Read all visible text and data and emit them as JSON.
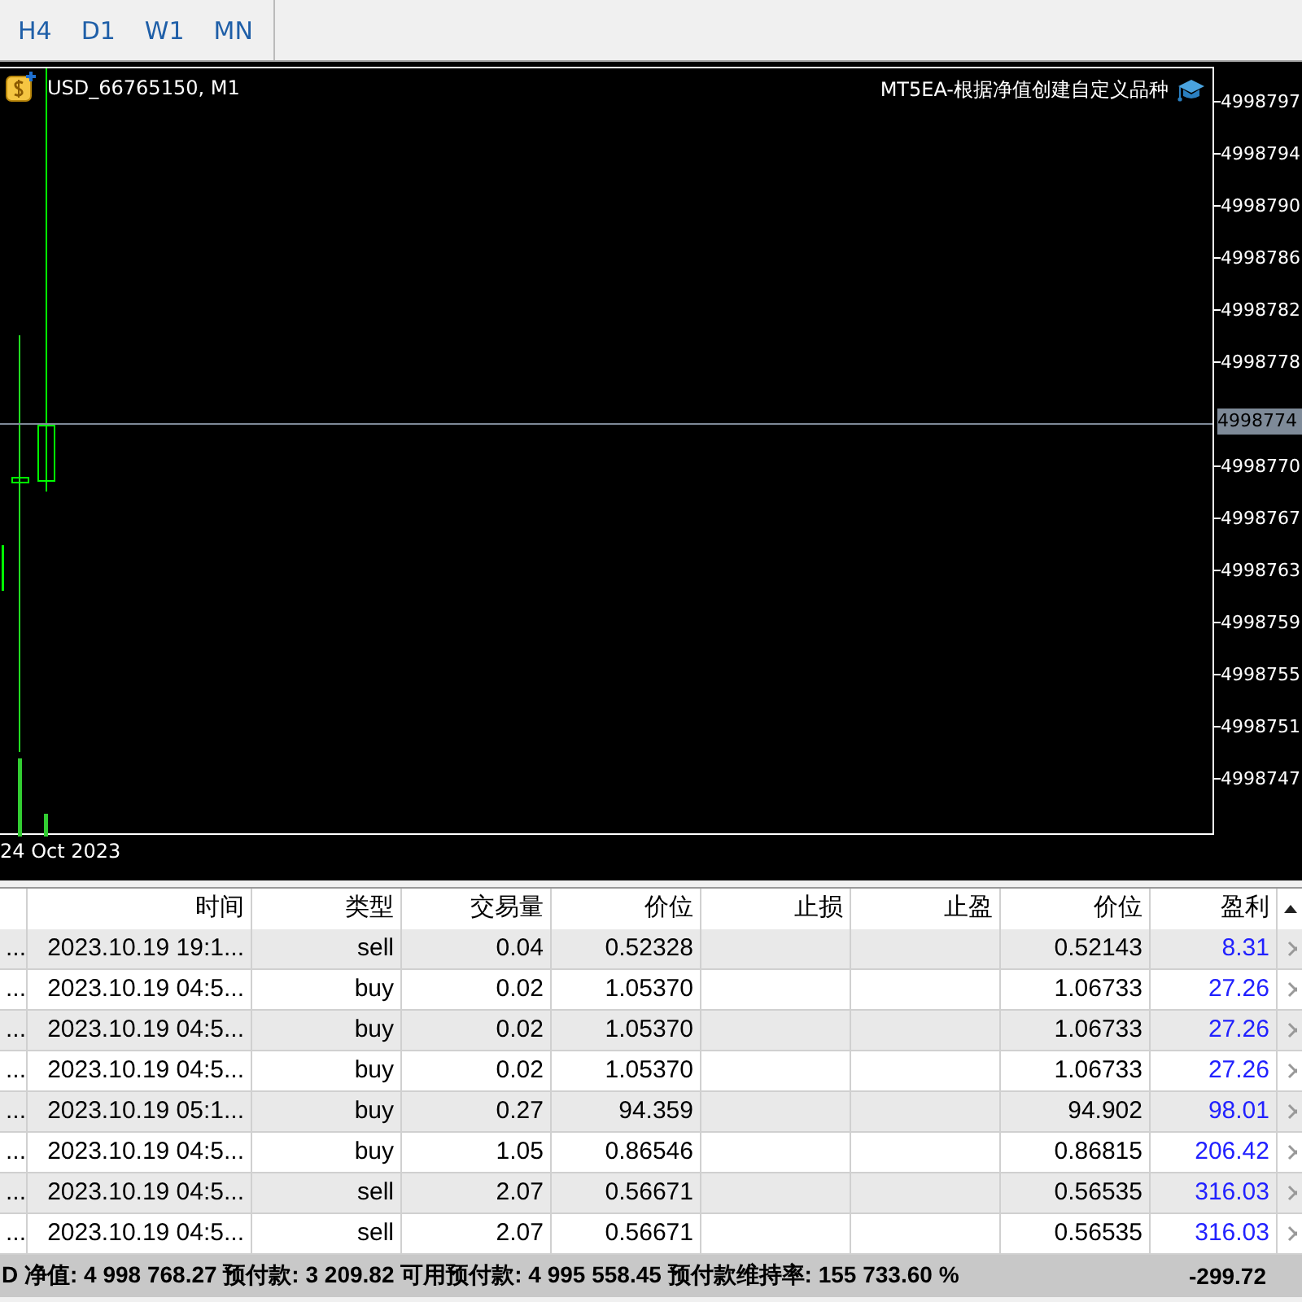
{
  "toolbar": {
    "timeframes": [
      {
        "label": "H4",
        "selected": false
      },
      {
        "label": "D1",
        "selected": false
      },
      {
        "label": "W1",
        "selected": false
      },
      {
        "label": "MN",
        "selected": false
      }
    ]
  },
  "chart": {
    "symbol": "USD_66765150, M1",
    "expert": "MT5EA-根据净值创建自定义品种",
    "price_axis": [
      "4998797",
      "4998794",
      "4998790",
      "4998786",
      "4998782",
      "4998778",
      "4998770",
      "4998767",
      "4998763",
      "4998759",
      "4998755",
      "4998751",
      "4998747"
    ],
    "current_price": "4998774",
    "date_label": "24 Oct 2023"
  },
  "table": {
    "columns": [
      "",
      "时间",
      "类型",
      "交易量",
      "价位",
      "止损",
      "止盈",
      "价位",
      "盈利"
    ],
    "rows": [
      {
        "column_1": "...",
        "time": "2023.10.19 19:1...",
        "type": "sell",
        "volume": "0.04",
        "open_price": "0.52328",
        "current_price": "0.52143",
        "profit": "8.31"
      },
      {
        "column_1": "...",
        "time": "2023.10.19 04:5...",
        "type": "buy",
        "volume": "0.02",
        "open_price": "1.05370",
        "current_price": "1.06733",
        "profit": "27.26"
      },
      {
        "column_1": "...",
        "time": "2023.10.19 04:5...",
        "type": "buy",
        "volume": "0.02",
        "open_price": "1.05370",
        "current_price": "1.06733",
        "profit": "27.26"
      },
      {
        "column_1": "...",
        "time": "2023.10.19 04:5...",
        "type": "buy",
        "volume": "0.02",
        "open_price": "1.05370",
        "current_price": "1.06733",
        "profit": "27.26"
      },
      {
        "column_1": "...",
        "time": "2023.10.19 05:1...",
        "type": "buy",
        "volume": "0.27",
        "open_price": "94.359",
        "current_price": "94.902",
        "profit": "98.01"
      },
      {
        "column_1": "...",
        "time": "2023.10.19 04:5...",
        "type": "buy",
        "volume": "1.05",
        "open_price": "0.86546",
        "current_price": "0.86815",
        "profit": "206.42"
      },
      {
        "column_1": "...",
        "time": "2023.10.19 04:5...",
        "type": "sell",
        "volume": "2.07",
        "open_price": "0.56671",
        "current_price": "0.56535",
        "profit": "316.03"
      },
      {
        "column_1": "...",
        "time": "2023.10.19 04:5...",
        "type": "sell",
        "volume": "2.07",
        "open_price": "0.56671",
        "current_price": "0.56535",
        "profit": "316.03"
      }
    ],
    "summary": "D  净值: 4 998 768.27  预付款: 3 209.82  可用预付款: 4 995 558.45  预付款维持率: 155 733.60 %",
    "total_profit": "-299.72"
  }
}
